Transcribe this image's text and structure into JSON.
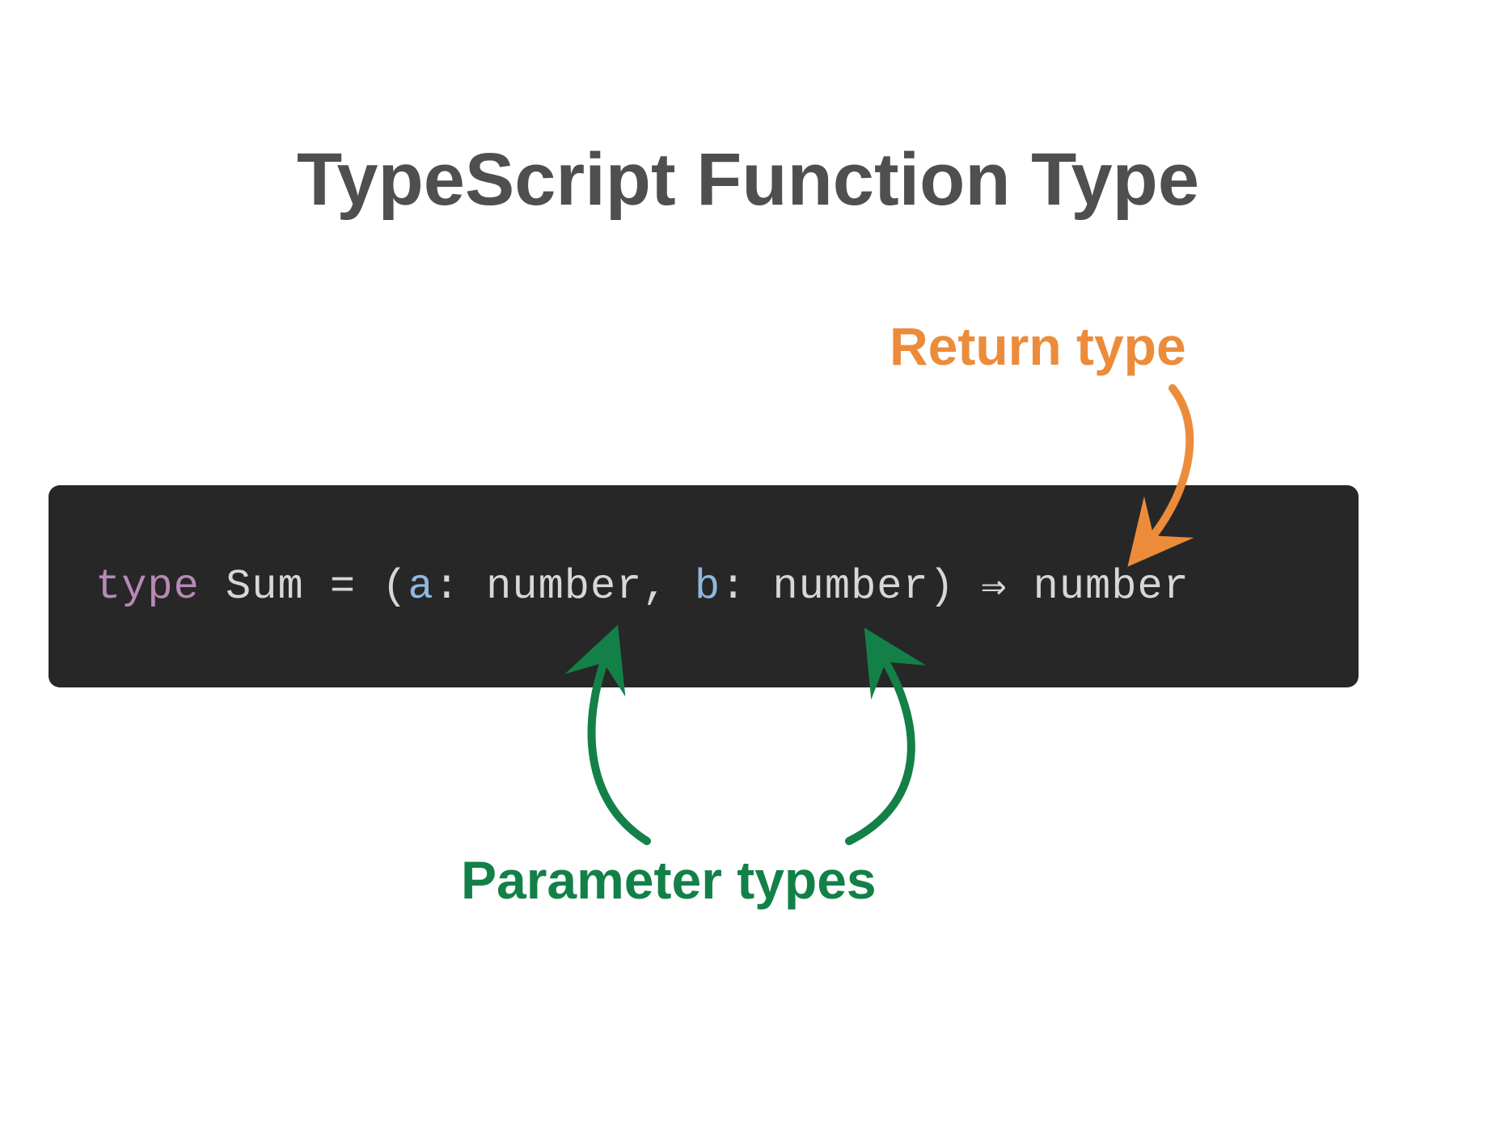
{
  "title": "TypeScript Function Type",
  "labels": {
    "return_type": "Return type",
    "parameter_types": "Parameter types"
  },
  "code": {
    "keyword": "type",
    "type_name": "Sum",
    "equals": " = ",
    "lparen": "(",
    "param1_name": "a",
    "colon1": ": ",
    "param1_type": "number",
    "comma": ", ",
    "param2_name": "b",
    "colon2": ": ",
    "param2_type": "number",
    "rparen": ")",
    "arrow": " ⇒ ",
    "return_type": "number"
  },
  "colors": {
    "title": "#4f4f4f",
    "return_label": "#ec8c3b",
    "param_label": "#138048",
    "code_bg": "#272727",
    "keyword": "#b68ab6",
    "param": "#8fb8de",
    "default_text": "#d7d7d7"
  }
}
